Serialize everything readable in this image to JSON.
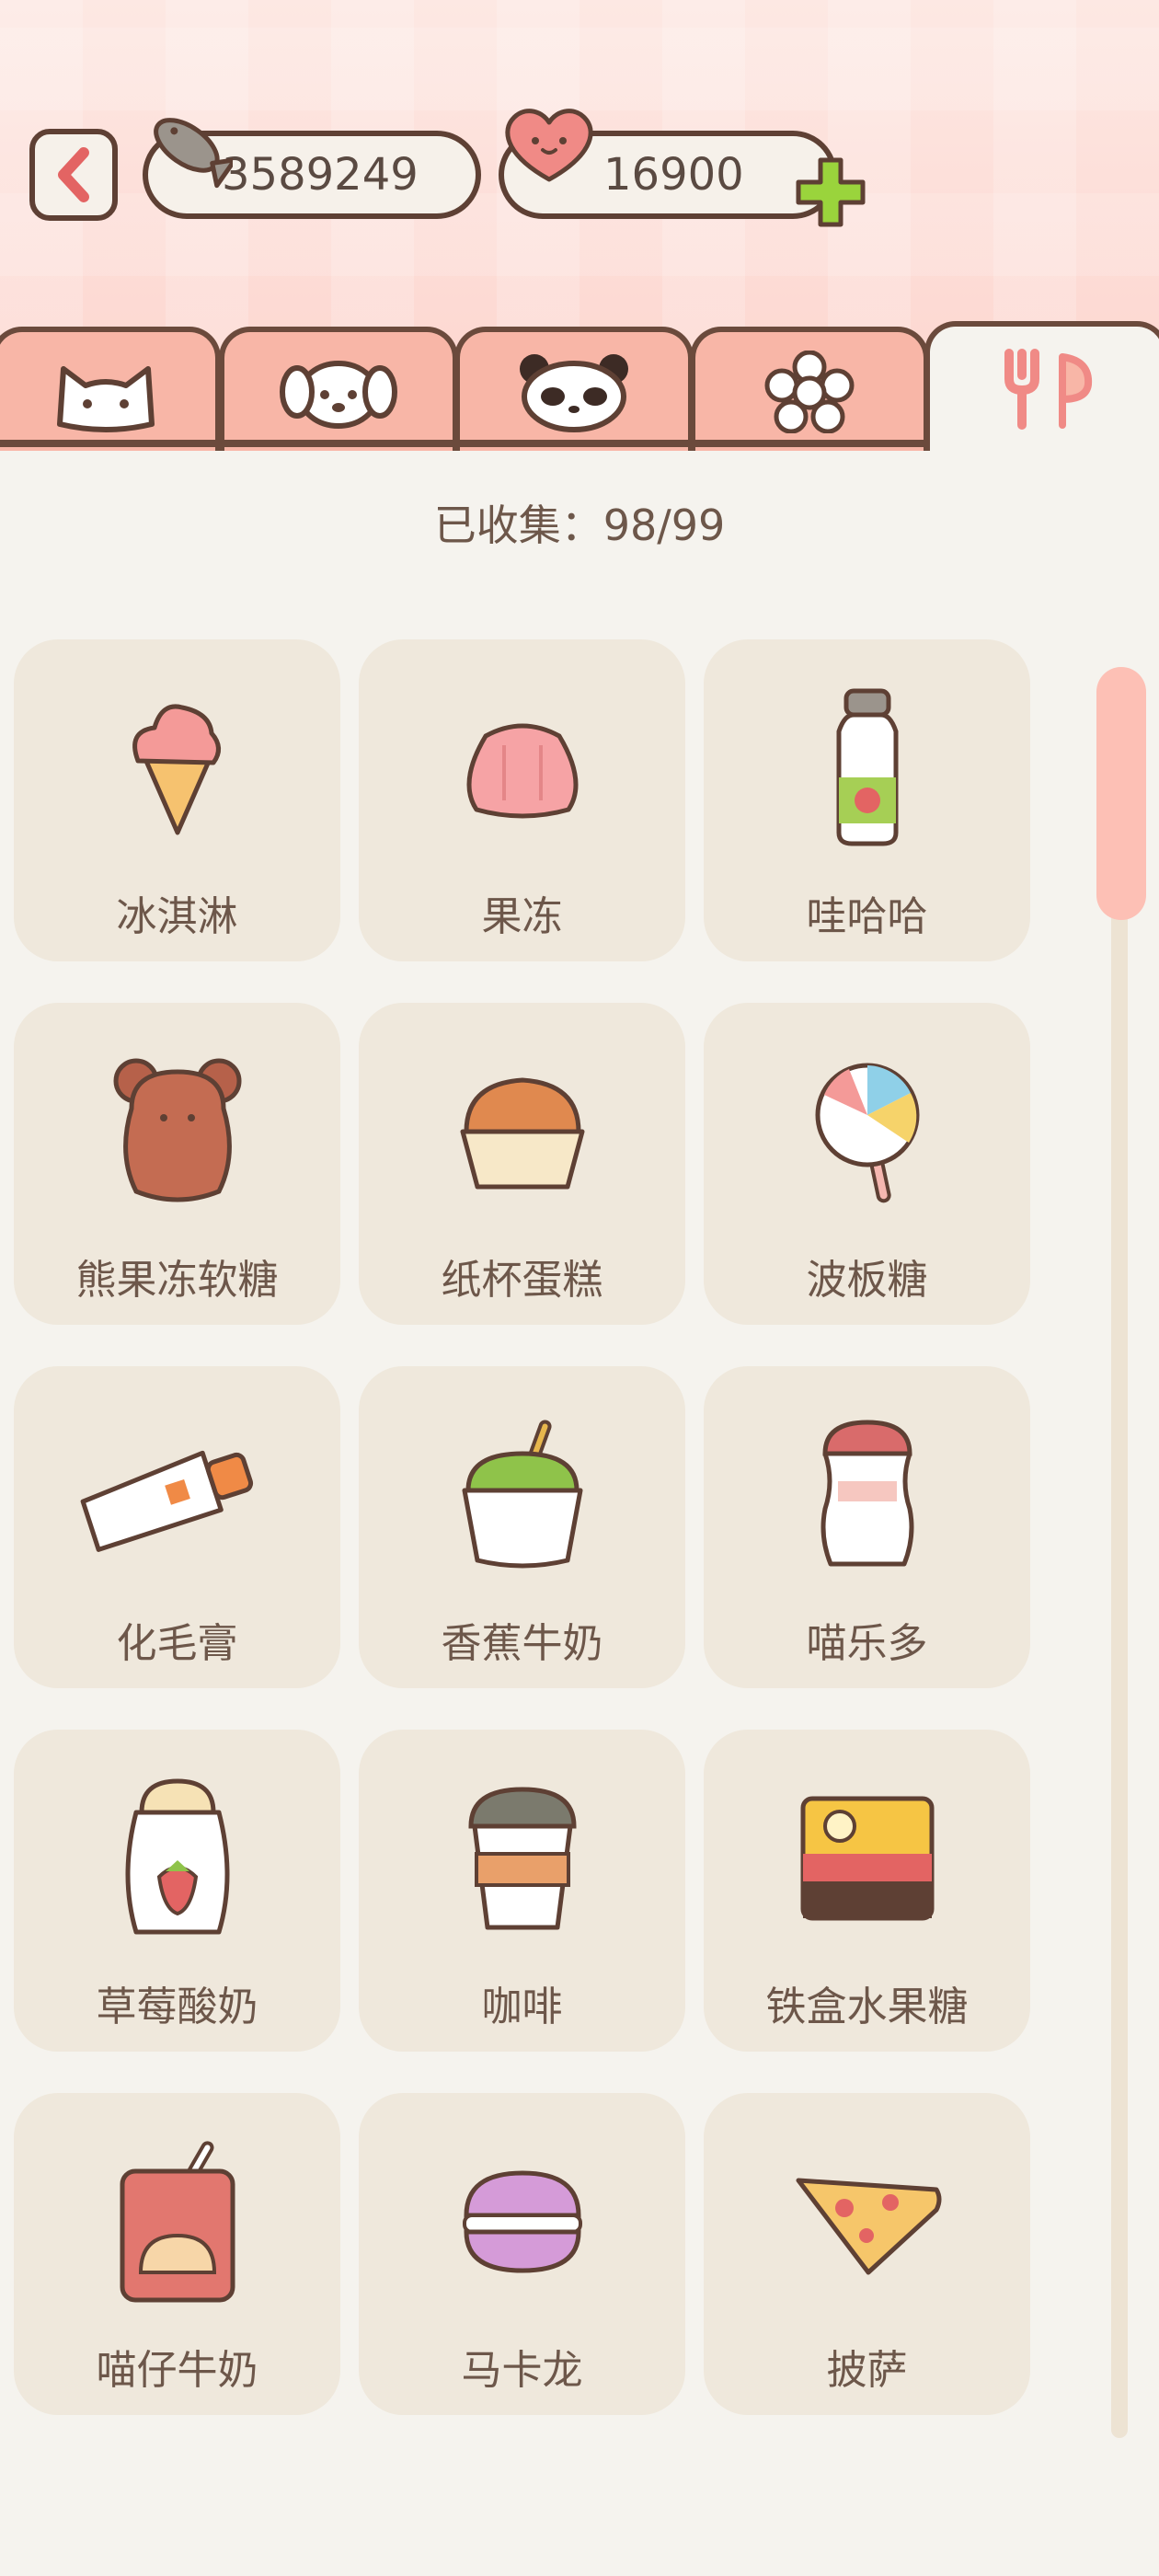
{
  "header": {
    "fish_count": "3589249",
    "heart_count": "16900"
  },
  "tabs": [
    {
      "name": "cat",
      "icon": "cat-face-icon"
    },
    {
      "name": "dog",
      "icon": "dog-face-icon"
    },
    {
      "name": "panda",
      "icon": "panda-face-icon"
    },
    {
      "name": "flower",
      "icon": "flower-icon"
    },
    {
      "name": "food",
      "icon": "fork-spoon-icon",
      "active": true
    }
  ],
  "collection": {
    "text": "已收集：98/99"
  },
  "items": [
    {
      "label": "冰淇淋",
      "icon": "ice-cream-icon"
    },
    {
      "label": "果冻",
      "icon": "jelly-icon"
    },
    {
      "label": "哇哈哈",
      "icon": "bottle-drink-icon"
    },
    {
      "label": "熊果冻软糖",
      "icon": "gummy-bear-icon"
    },
    {
      "label": "纸杯蛋糕",
      "icon": "cupcake-icon"
    },
    {
      "label": "波板糖",
      "icon": "lollipop-icon"
    },
    {
      "label": "化毛膏",
      "icon": "paste-tube-icon"
    },
    {
      "label": "香蕉牛奶",
      "icon": "banana-milk-icon"
    },
    {
      "label": "喵乐多",
      "icon": "yogurt-drink-icon"
    },
    {
      "label": "草莓酸奶",
      "icon": "strawberry-yogurt-icon"
    },
    {
      "label": "咖啡",
      "icon": "coffee-cup-icon"
    },
    {
      "label": "铁盒水果糖",
      "icon": "candy-tin-icon"
    },
    {
      "label": "喵仔牛奶",
      "icon": "milk-carton-icon"
    },
    {
      "label": "马卡龙",
      "icon": "macaron-icon"
    },
    {
      "label": "披萨",
      "icon": "pizza-slice-icon"
    }
  ],
  "colors": {
    "outline": "#5e4034",
    "tab_inactive": "#f8b6a7",
    "card_bg": "#efe8dc",
    "page_bg": "#f5f3ee",
    "accent_green": "#9ad43c",
    "accent_pink": "#f08a86"
  }
}
